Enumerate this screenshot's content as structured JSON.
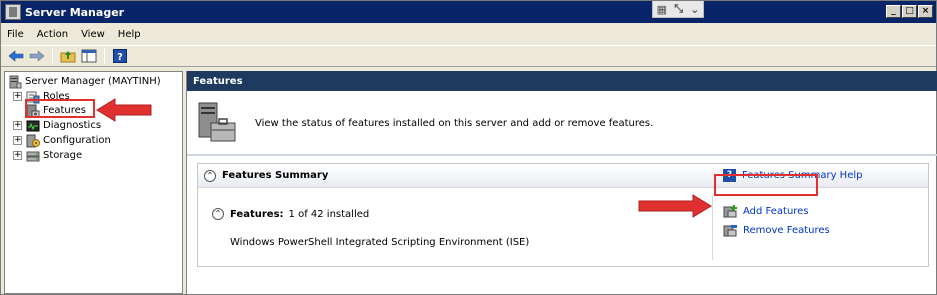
{
  "window": {
    "title": "Server Manager",
    "controls": [
      "_",
      "□",
      "×"
    ]
  },
  "menu": {
    "items": [
      "File",
      "Action",
      "View",
      "Help"
    ]
  },
  "tree": {
    "root": "Server Manager (MAYTINH)",
    "items": [
      {
        "label": "Roles",
        "expander": "+"
      },
      {
        "label": "Features",
        "expander": ""
      },
      {
        "label": "Diagnostics",
        "expander": "+"
      },
      {
        "label": "Configuration",
        "expander": "+"
      },
      {
        "label": "Storage",
        "expander": "+"
      }
    ]
  },
  "content": {
    "header": "Features",
    "intro": "View the status of features installed on this server and add or remove features.",
    "summary": {
      "title": "Features Summary",
      "help_link": "Features Summary Help",
      "features_label": "Features:",
      "features_count": "1 of 42 installed",
      "installed_item": "Windows PowerShell Integrated Scripting Environment (ISE)",
      "add_link": "Add Features",
      "remove_link": "Remove Features"
    }
  },
  "colors": {
    "title_bar": "#0a246a",
    "content_header": "#1e3a5f",
    "link": "#0033cc",
    "annotation": "#e03030"
  }
}
